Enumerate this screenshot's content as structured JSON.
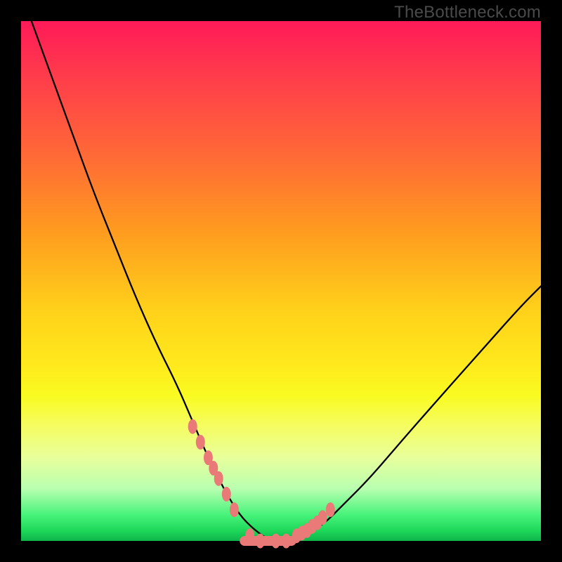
{
  "watermark": "TheBottleneck.com",
  "colors": {
    "curve": "#000000",
    "markers": "#e97a77",
    "background_top": "#ff1a58",
    "background_bottom": "#0fb44a"
  },
  "chart_data": {
    "type": "line",
    "title": "",
    "xlabel": "",
    "ylabel": "",
    "xlim": [
      0,
      100
    ],
    "ylim": [
      0,
      100
    ],
    "annotations": [
      "TheBottleneck.com"
    ],
    "series": [
      {
        "name": "bottleneck-curve",
        "x": [
          2,
          6,
          10,
          14,
          18,
          22,
          26,
          30,
          33,
          36,
          39,
          42,
          45,
          48,
          51,
          54,
          58,
          62,
          67,
          73,
          80,
          88,
          96,
          100
        ],
        "y": [
          100,
          89,
          78,
          67,
          57,
          47,
          38,
          30,
          23,
          16,
          10,
          5,
          2,
          0,
          0,
          1,
          3,
          7,
          12,
          19,
          27,
          36,
          45,
          49
        ]
      }
    ],
    "markers": {
      "name": "highlighted-points",
      "description": "salmon markers clustered near the curve minimum on both arms",
      "x": [
        33,
        34.5,
        36,
        37,
        38,
        39.5,
        41,
        44,
        46,
        49,
        51,
        53,
        54,
        55,
        56,
        57,
        58,
        59.5
      ],
      "y": [
        22,
        19,
        16,
        14,
        12,
        9,
        6,
        1,
        0,
        0,
        0,
        1,
        1.5,
        2,
        2.8,
        3.5,
        4.5,
        6
      ]
    },
    "flat_segment": {
      "description": "thick salmon segment along the curve bottom",
      "x0": 43,
      "x1": 52,
      "y": 0
    }
  }
}
